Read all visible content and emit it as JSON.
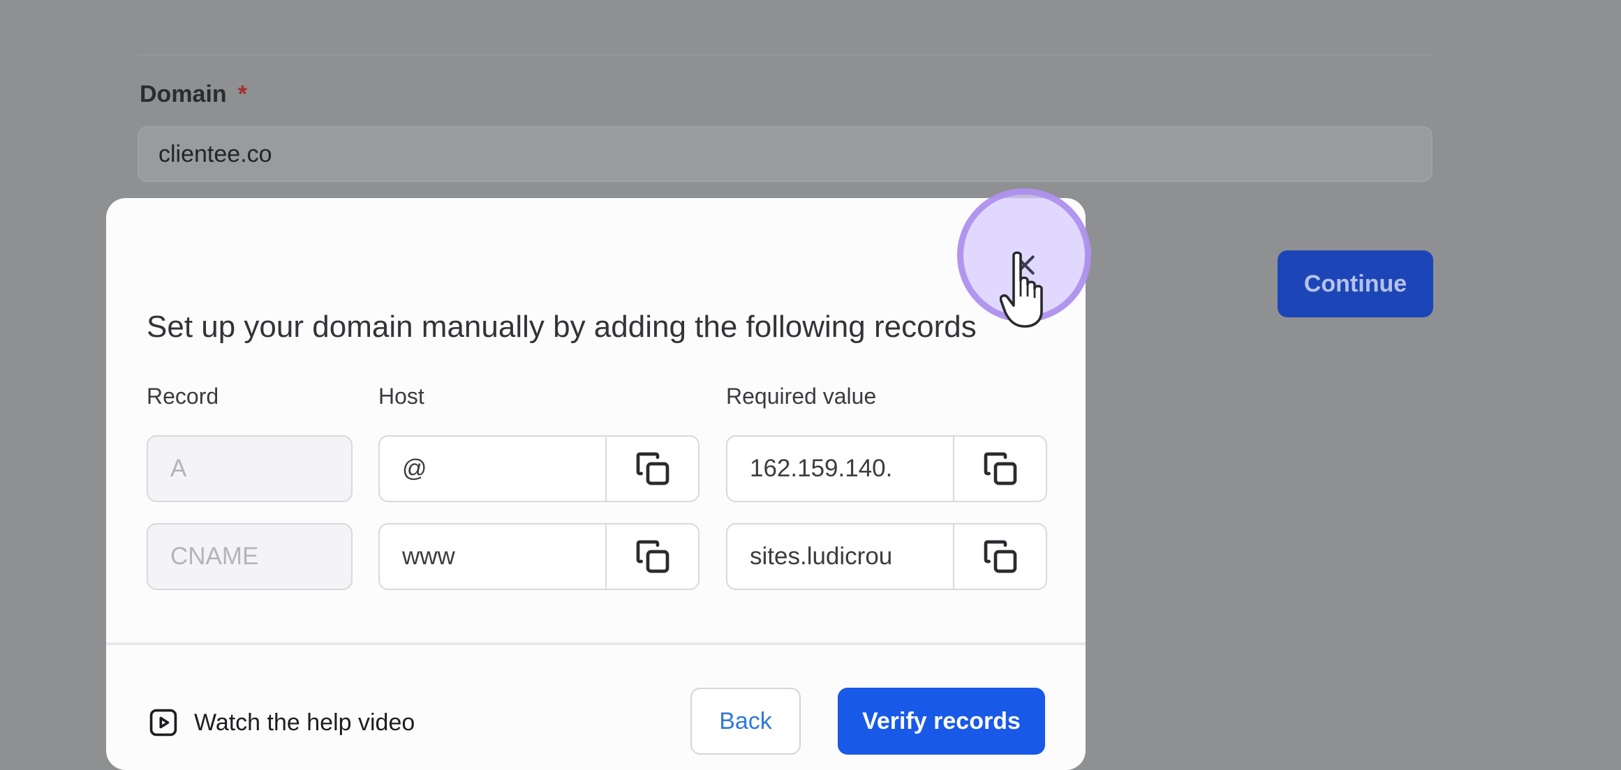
{
  "background_form": {
    "domain_label": "Domain",
    "required_marker": "*",
    "domain_value": "clientee.co",
    "continue_label": "Continue"
  },
  "modal": {
    "title": "Set up your domain manually by adding the following records",
    "columns": {
      "record": "Record",
      "host": "Host",
      "required_value": "Required value"
    },
    "records": [
      {
        "record": "A",
        "host": "@",
        "value": "162.159.140."
      },
      {
        "record": "CNAME",
        "host": "www",
        "value": "sites.ludicrou"
      }
    ],
    "help_link": "Watch the help video",
    "back_label": "Back",
    "verify_label": "Verify records"
  },
  "colors": {
    "overlay_bg": "#8f9092",
    "primary": "#1859e8",
    "link": "#3179d8",
    "click_highlight": "#d6caff"
  },
  "icons": {
    "close": "close-icon",
    "copy": "copy-icon",
    "play": "play-video-icon",
    "cursor": "hand-pointer-cursor-icon"
  }
}
